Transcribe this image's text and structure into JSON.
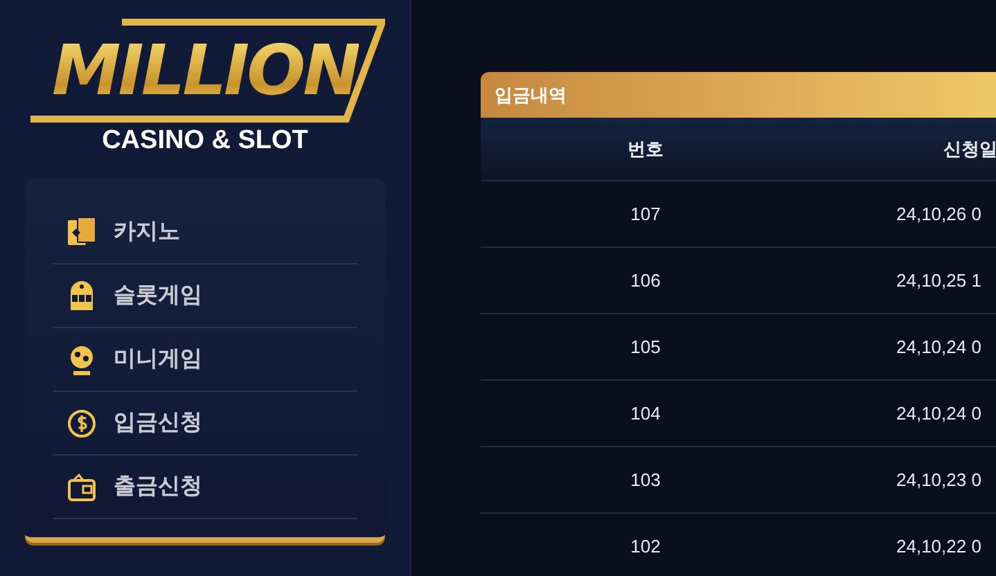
{
  "logo": {
    "title": "MILLION",
    "subtitle": "CASINO & SLOT"
  },
  "menu": [
    {
      "kind": "cards",
      "label": "카지노"
    },
    {
      "kind": "slot",
      "label": "슬롯게임"
    },
    {
      "kind": "mini",
      "label": "미니게임"
    },
    {
      "kind": "coin",
      "label": "입금신청"
    },
    {
      "kind": "wallet",
      "label": "출금신청"
    }
  ],
  "panel": {
    "title": "입금내역",
    "columns": [
      "번호",
      "신청일"
    ],
    "rows": [
      [
        "107",
        "24,10,26 0"
      ],
      [
        "106",
        "24,10,25 1"
      ],
      [
        "105",
        "24,10,24 0"
      ],
      [
        "104",
        "24,10,24 0"
      ],
      [
        "103",
        "24,10,23 0"
      ],
      [
        "102",
        "24,10,22 0"
      ]
    ]
  }
}
